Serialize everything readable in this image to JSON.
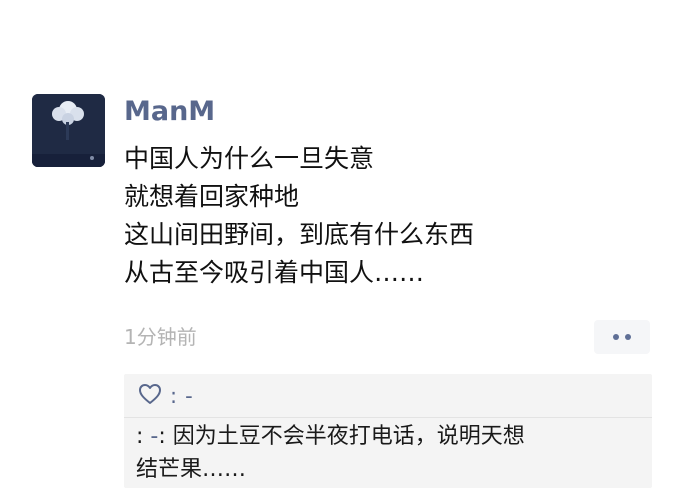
{
  "post": {
    "username": "ManM",
    "lines": [
      "中国人为什么一旦失意",
      "就想着回家种地",
      "这山间田野间，到底有什么东西",
      "从古至今吸引着中国人……"
    ],
    "timestamp": "1分钟前"
  },
  "likes": {
    "icon": "heart-icon",
    "separator": ":",
    "names": "-"
  },
  "comment": {
    "author": "-",
    "separator": ":",
    "prefix": ":",
    "line1": "因为土豆不会半夜打电话，说明天想",
    "line2": "结芒果……"
  },
  "colors": {
    "name_link": "#58678c",
    "timestamp": "#b4b4b4",
    "comment_bg": "#f4f4f4"
  }
}
